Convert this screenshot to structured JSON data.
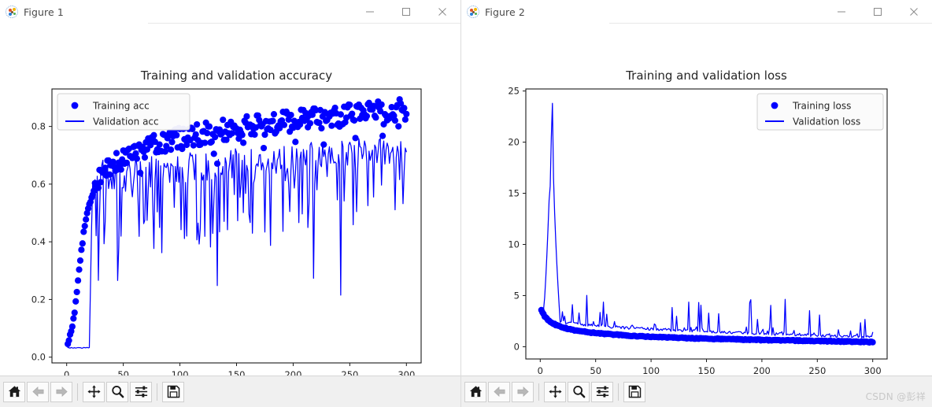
{
  "windows": [
    {
      "title": "Figure 1",
      "icon": "matplotlib-icon",
      "controls": {
        "minimize": "Minimize",
        "maximize": "Maximize",
        "close": "Close"
      }
    },
    {
      "title": "Figure 2",
      "icon": "matplotlib-icon",
      "controls": {
        "minimize": "Minimize",
        "maximize": "Maximize",
        "close": "Close"
      }
    }
  ],
  "toolbar": {
    "buttons": [
      {
        "name": "home-icon",
        "tooltip": "Reset original view"
      },
      {
        "name": "back-arrow-icon",
        "tooltip": "Back to previous view"
      },
      {
        "name": "forward-arrow-icon",
        "tooltip": "Forward to next view"
      },
      {
        "name": "pan-move-icon",
        "tooltip": "Pan axes with left mouse, zoom with right"
      },
      {
        "name": "zoom-magnifier-icon",
        "tooltip": "Zoom to rectangle"
      },
      {
        "name": "configure-subplots-icon",
        "tooltip": "Configure subplots"
      },
      {
        "name": "save-floppy-icon",
        "tooltip": "Save the figure"
      }
    ]
  },
  "watermark": "CSDN @彭祥",
  "chart_data": [
    {
      "type": "scatter",
      "title": "Training and validation accuracy",
      "xlabel": "",
      "ylabel": "",
      "xlim": [
        -13,
        313
      ],
      "ylim": [
        -0.02,
        0.93
      ],
      "xticks": [
        0,
        50,
        100,
        150,
        200,
        250,
        300
      ],
      "yticks": [
        0.0,
        0.2,
        0.4,
        0.6,
        0.8
      ],
      "ytick_labels": [
        "0.0",
        "0.2",
        "0.4",
        "0.6",
        "0.8"
      ],
      "grid": false,
      "legend_position": "upper left",
      "color": "#0000FF",
      "series": [
        {
          "name": "Training acc",
          "style": "markers",
          "description": "Scatter of training accuracy per epoch, rising from ~0.05 at epoch 1 to ~0.87 at epoch 300",
          "x": [
            1,
            2,
            3,
            4,
            5,
            6,
            7,
            8,
            9,
            10,
            11,
            12,
            13,
            14,
            15,
            16,
            17,
            18,
            19,
            20,
            22,
            24,
            26,
            28,
            30,
            33,
            36,
            39,
            42,
            45,
            48,
            52,
            56,
            60,
            64,
            68,
            72,
            76,
            80,
            85,
            90,
            95,
            100,
            105,
            110,
            115,
            120,
            125,
            130,
            135,
            140,
            145,
            150,
            155,
            160,
            165,
            170,
            175,
            180,
            185,
            190,
            195,
            200,
            205,
            210,
            215,
            220,
            225,
            230,
            235,
            240,
            245,
            250,
            255,
            260,
            265,
            270,
            275,
            280,
            285,
            290,
            295,
            300
          ],
          "y": [
            0.05,
            0.06,
            0.075,
            0.09,
            0.11,
            0.135,
            0.16,
            0.19,
            0.225,
            0.26,
            0.3,
            0.335,
            0.37,
            0.4,
            0.43,
            0.455,
            0.475,
            0.495,
            0.515,
            0.53,
            0.555,
            0.575,
            0.595,
            0.61,
            0.625,
            0.64,
            0.652,
            0.663,
            0.672,
            0.68,
            0.688,
            0.696,
            0.703,
            0.71,
            0.716,
            0.722,
            0.727,
            0.732,
            0.737,
            0.743,
            0.748,
            0.753,
            0.758,
            0.762,
            0.766,
            0.77,
            0.774,
            0.777,
            0.781,
            0.784,
            0.787,
            0.79,
            0.793,
            0.796,
            0.799,
            0.802,
            0.805,
            0.807,
            0.81,
            0.812,
            0.815,
            0.817,
            0.82,
            0.822,
            0.824,
            0.826,
            0.828,
            0.83,
            0.832,
            0.834,
            0.836,
            0.838,
            0.84,
            0.842,
            0.844,
            0.846,
            0.848,
            0.85,
            0.852,
            0.854,
            0.856,
            0.858,
            0.86
          ]
        },
        {
          "name": "Validation acc",
          "style": "line",
          "description": "Noisy validation accuracy line, flat at ~0.03 until epoch 20, then oscillating between ~0.25 and ~0.78",
          "x_start": 1,
          "x_end": 300,
          "flat_until": 20,
          "flat_value": 0.032,
          "trend_start": 0.6,
          "trend_end": 0.7,
          "noise_amplitude": 0.22
        }
      ]
    },
    {
      "type": "line",
      "title": "Training and validation loss",
      "xlabel": "",
      "ylabel": "",
      "xlim": [
        -13,
        313
      ],
      "ylim": [
        -1.2,
        25.2
      ],
      "xticks": [
        0,
        50,
        100,
        150,
        200,
        250,
        300
      ],
      "yticks": [
        0,
        5,
        10,
        15,
        20,
        25
      ],
      "ytick_labels": [
        "0",
        "5",
        "10",
        "15",
        "20",
        "25"
      ],
      "grid": false,
      "legend_position": "upper right",
      "color": "#0000FF",
      "series": [
        {
          "name": "Training loss",
          "style": "markers",
          "description": "Training loss scatter decaying from ~3.6 at epoch 1 to ~0.4 at epoch 300",
          "x": [
            1,
            2,
            3,
            4,
            5,
            6,
            7,
            8,
            9,
            10,
            12,
            14,
            16,
            18,
            20,
            24,
            28,
            32,
            36,
            40,
            45,
            50,
            55,
            60,
            65,
            70,
            75,
            80,
            85,
            90,
            95,
            100,
            110,
            120,
            130,
            140,
            150,
            160,
            170,
            180,
            190,
            200,
            210,
            220,
            230,
            240,
            250,
            260,
            270,
            280,
            290,
            300
          ],
          "y": [
            3.6,
            3.35,
            3.15,
            2.98,
            2.84,
            2.72,
            2.62,
            2.53,
            2.45,
            2.38,
            2.25,
            2.14,
            2.05,
            1.97,
            1.9,
            1.78,
            1.68,
            1.6,
            1.53,
            1.47,
            1.4,
            1.34,
            1.29,
            1.24,
            1.2,
            1.16,
            1.12,
            1.09,
            1.06,
            1.03,
            1.0,
            0.98,
            0.93,
            0.89,
            0.85,
            0.82,
            0.79,
            0.76,
            0.73,
            0.71,
            0.68,
            0.66,
            0.64,
            0.62,
            0.6,
            0.58,
            0.56,
            0.54,
            0.52,
            0.5,
            0.47,
            0.44
          ]
        },
        {
          "name": "Validation loss",
          "style": "line",
          "description": "Validation loss with large early spike peaking ~23.8 near epoch 11, then decaying to ~1 with intermittent spikes up to ~5",
          "peak_value": 23.8,
          "peak_epoch": 11,
          "baseline_start": 3.6,
          "baseline_end": 0.8,
          "spike_max": 5.1,
          "x_start": 1,
          "x_end": 300
        }
      ]
    }
  ]
}
